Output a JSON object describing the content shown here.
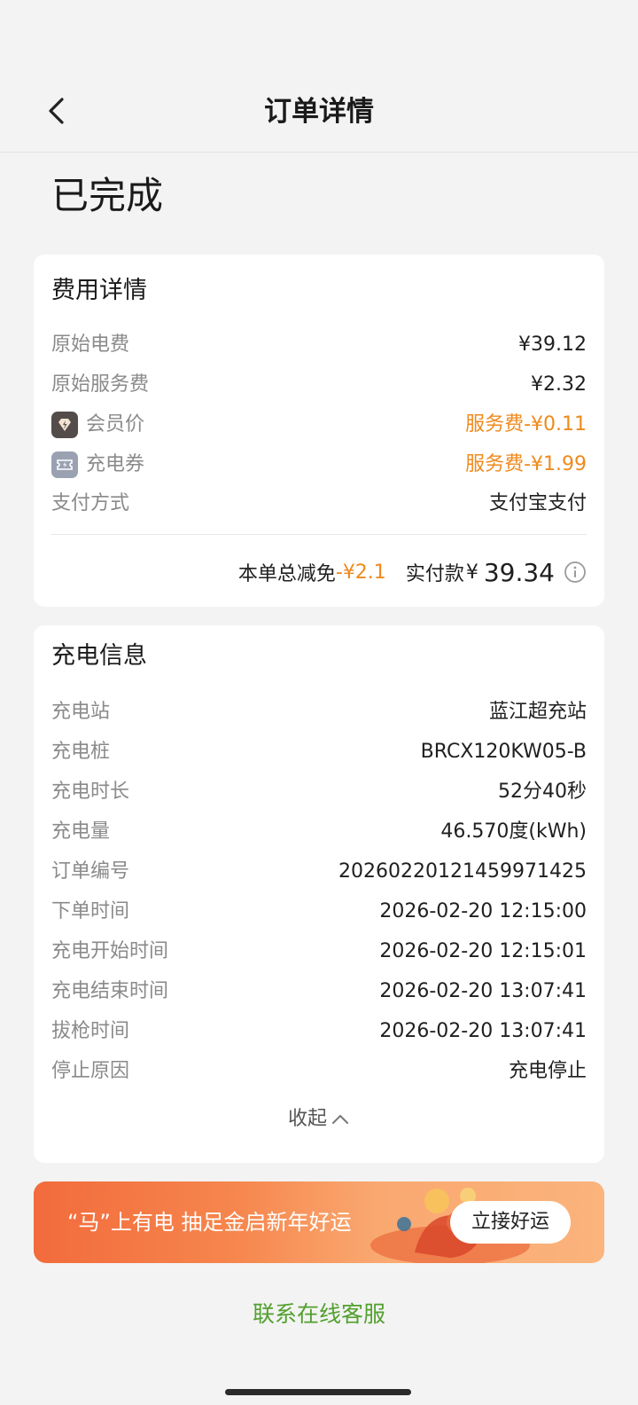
{
  "header": {
    "title": "订单详情"
  },
  "order_status": "已完成",
  "fee_details": {
    "title": "费用详情",
    "rows": [
      {
        "label": "原始电费",
        "value": "¥39.12"
      },
      {
        "label": "原始服务费",
        "value": "¥2.32"
      },
      {
        "label": "会员价",
        "value": "服务费-¥0.11",
        "icon": "member-diamond-icon"
      },
      {
        "label": "充电券",
        "value": "服务费-¥1.99",
        "icon": "ticket-icon"
      },
      {
        "label": "支付方式",
        "value": "支付宝支付"
      }
    ],
    "total_discount_label": "本单总减免",
    "total_discount_value": "-¥2.1",
    "paid_label": "实付款",
    "paid_currency": "¥",
    "paid_amount": "39.34"
  },
  "charging_info": {
    "title": "充电信息",
    "rows": [
      {
        "label": "充电站",
        "value": "蓝江超充站"
      },
      {
        "label": "充电桩",
        "value": "BRCX120KW05-B"
      },
      {
        "label": "充电时长",
        "value": "52分40秒"
      },
      {
        "label": "充电量",
        "value": "46.570度(kWh)"
      },
      {
        "label": "订单编号",
        "value": "20260220121459971425"
      },
      {
        "label": "下单时间",
        "value": "2026-02-20 12:15:00"
      },
      {
        "label": "充电开始时间",
        "value": "2026-02-20 12:15:01"
      },
      {
        "label": "充电结束时间",
        "value": "2026-02-20 13:07:41"
      },
      {
        "label": "拔枪时间",
        "value": "2026-02-20 13:07:41"
      },
      {
        "label": "停止原因",
        "value": "充电停止"
      }
    ],
    "collapse_label": "收起"
  },
  "banner": {
    "text": "“马”上有电 抽足金启新年好运",
    "button": "立接好运"
  },
  "contact_label": "联系在线客服",
  "colors": {
    "accent_orange": "#ef8a1c",
    "link_green": "#52a02e"
  }
}
